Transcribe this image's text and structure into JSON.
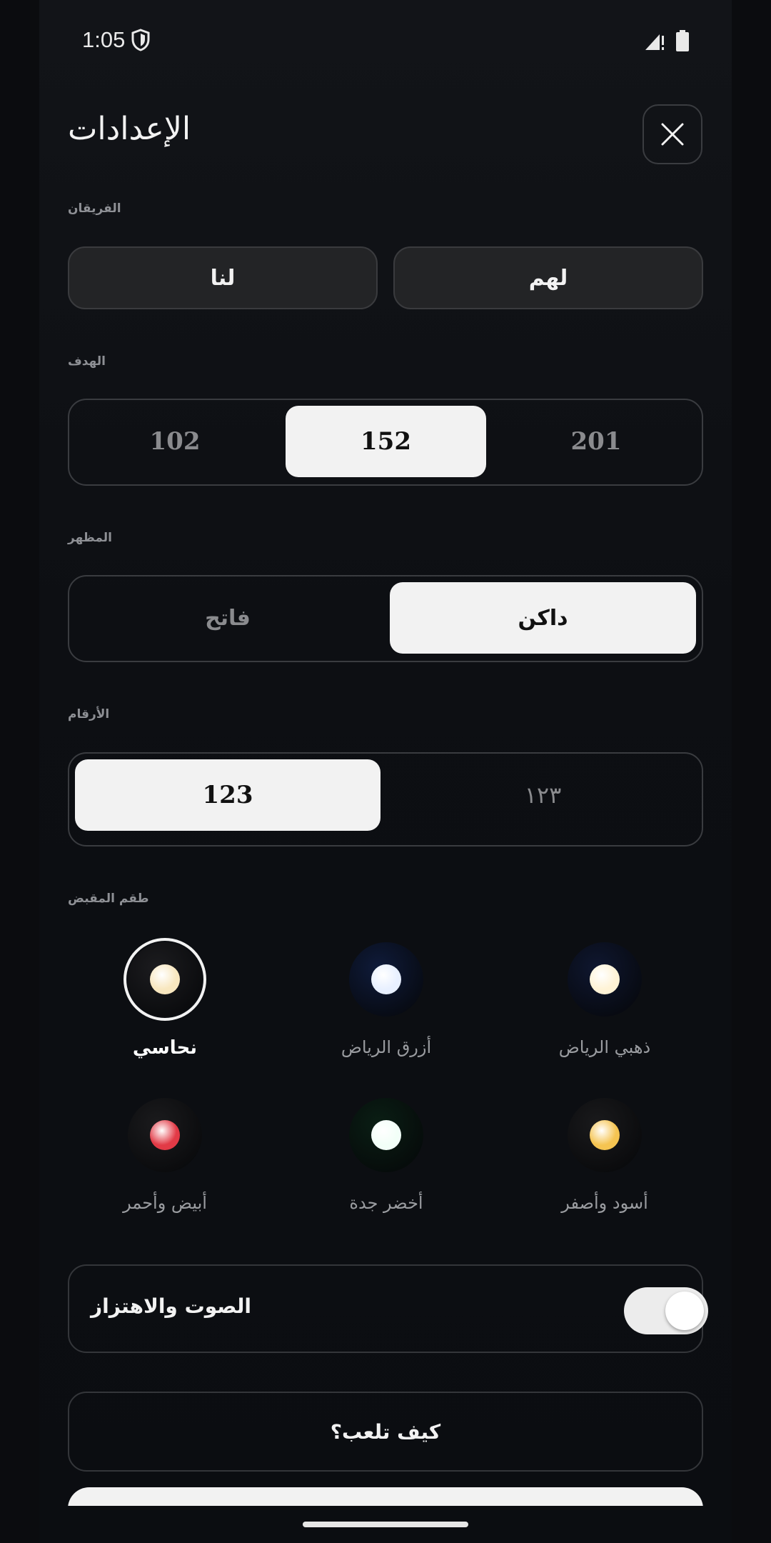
{
  "status": {
    "time": "1:05"
  },
  "header": {
    "title": "الإعدادات"
  },
  "teams": {
    "label": "الفريقان",
    "us": "لنا",
    "them": "لهم"
  },
  "target": {
    "label": "الهدف",
    "options": [
      "102",
      "152",
      "201"
    ],
    "selected": "152"
  },
  "appearance": {
    "label": "المظهر",
    "options": [
      "فاتح",
      "داكن"
    ],
    "selected": "داكن"
  },
  "numerals": {
    "label": "الأرقام",
    "options": [
      "123",
      "١٢٣"
    ],
    "selected": "123"
  },
  "theme": {
    "label": "طقم المقبض",
    "selected": "نحاسي",
    "items": [
      {
        "name": "نحاسي",
        "outer": "#1c1c1f",
        "dot": "#f8e7bf"
      },
      {
        "name": "أزرق الرياض",
        "outer": "#0f1b3a",
        "dot": "#e8f0ff"
      },
      {
        "name": "ذهبي الرياض",
        "outer": "#0f1730",
        "dot": "#fff3d6"
      },
      {
        "name": "أبيض وأحمر",
        "outer": "#1b1b1d",
        "dot": "#e23a46"
      },
      {
        "name": "أخضر جدة",
        "outer": "#0a1e14",
        "dot": "#f2fff8"
      },
      {
        "name": "أسود وأصفر",
        "outer": "#1a1a1c",
        "dot": "#f5c451"
      }
    ]
  },
  "sound": {
    "label": "الصوت والاهتزاز",
    "enabled": true
  },
  "howto": {
    "label": "كيف تلعب؟"
  },
  "colors": {
    "background": "#0b0d11",
    "active_segment": "#f2f2f2",
    "inactive_text": "#8a8b8e"
  }
}
